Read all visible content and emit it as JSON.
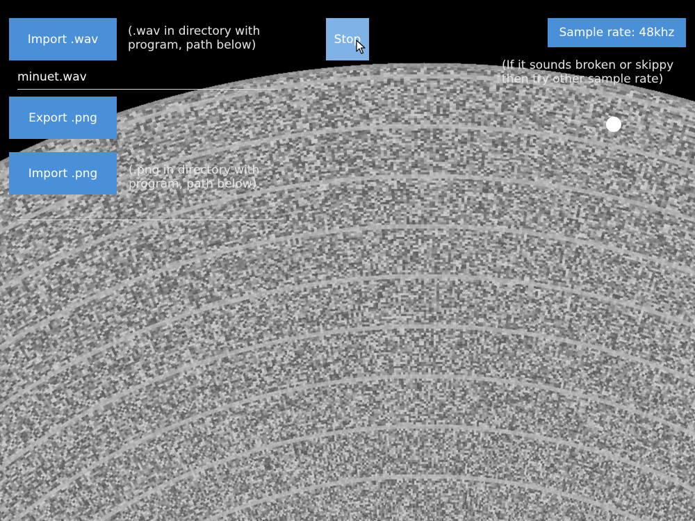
{
  "app": {
    "record_image_label": "record-image",
    "colors": {
      "background": "#000000",
      "button": "#4a90d9",
      "button_active": "#7fb3e8",
      "text": "#ffffff"
    }
  },
  "controls": {
    "import_wav_label": "Import .wav",
    "import_wav_note": "(.wav in directory with\nprogram, path below)",
    "wav_path_value": "minuet.wav",
    "export_png_label": "Export .png",
    "import_png_label": "Import .png",
    "import_png_note": "(.png in directory with\nprogram, path below)",
    "png_path_value": "",
    "stop_label": "Stop",
    "sample_rate_label": "Sample rate: 48khz",
    "sample_rate_note": "(If it sounds broken or skippy\nthen try other sample rate)"
  },
  "playback": {
    "playhead_icon": "playhead-dot-icon",
    "cursor_icon": "mouse-pointer-icon"
  }
}
